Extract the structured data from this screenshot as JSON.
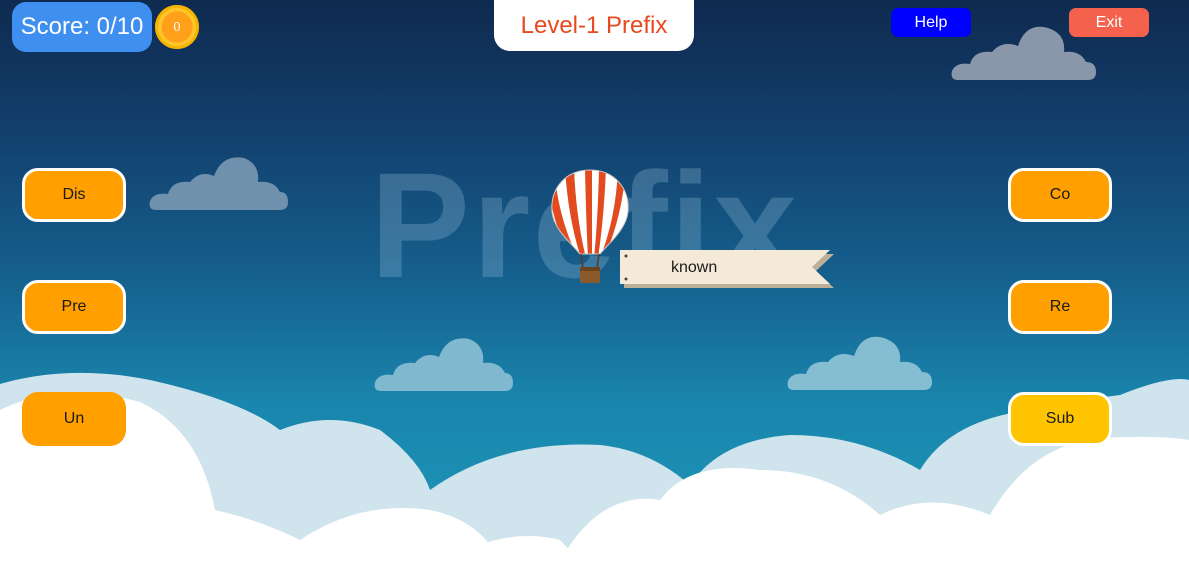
{
  "background_word": "Prefix",
  "hud": {
    "score_label": "Score: 0/10",
    "coin_value": "0",
    "level_title": "Level-1 Prefix",
    "help_label": "Help",
    "exit_label": "Exit"
  },
  "prefixes_left": [
    "Dis",
    "Pre",
    "Un"
  ],
  "prefixes_right": [
    "Co",
    "Re",
    "Sub"
  ],
  "target_word": "known",
  "colors": {
    "score_bg": "#3f8ff0",
    "title_text": "#e8491d",
    "help_bg": "#0000ff",
    "exit_bg": "#f4614c",
    "option_bg": "#ff9f00",
    "option_highlight_bg": "#ffc400",
    "coin": "#ff9f1a"
  },
  "icons": {
    "balloon": "hot-air-balloon-icon",
    "coin": "coin-icon",
    "clouds": "cloud-icon"
  }
}
